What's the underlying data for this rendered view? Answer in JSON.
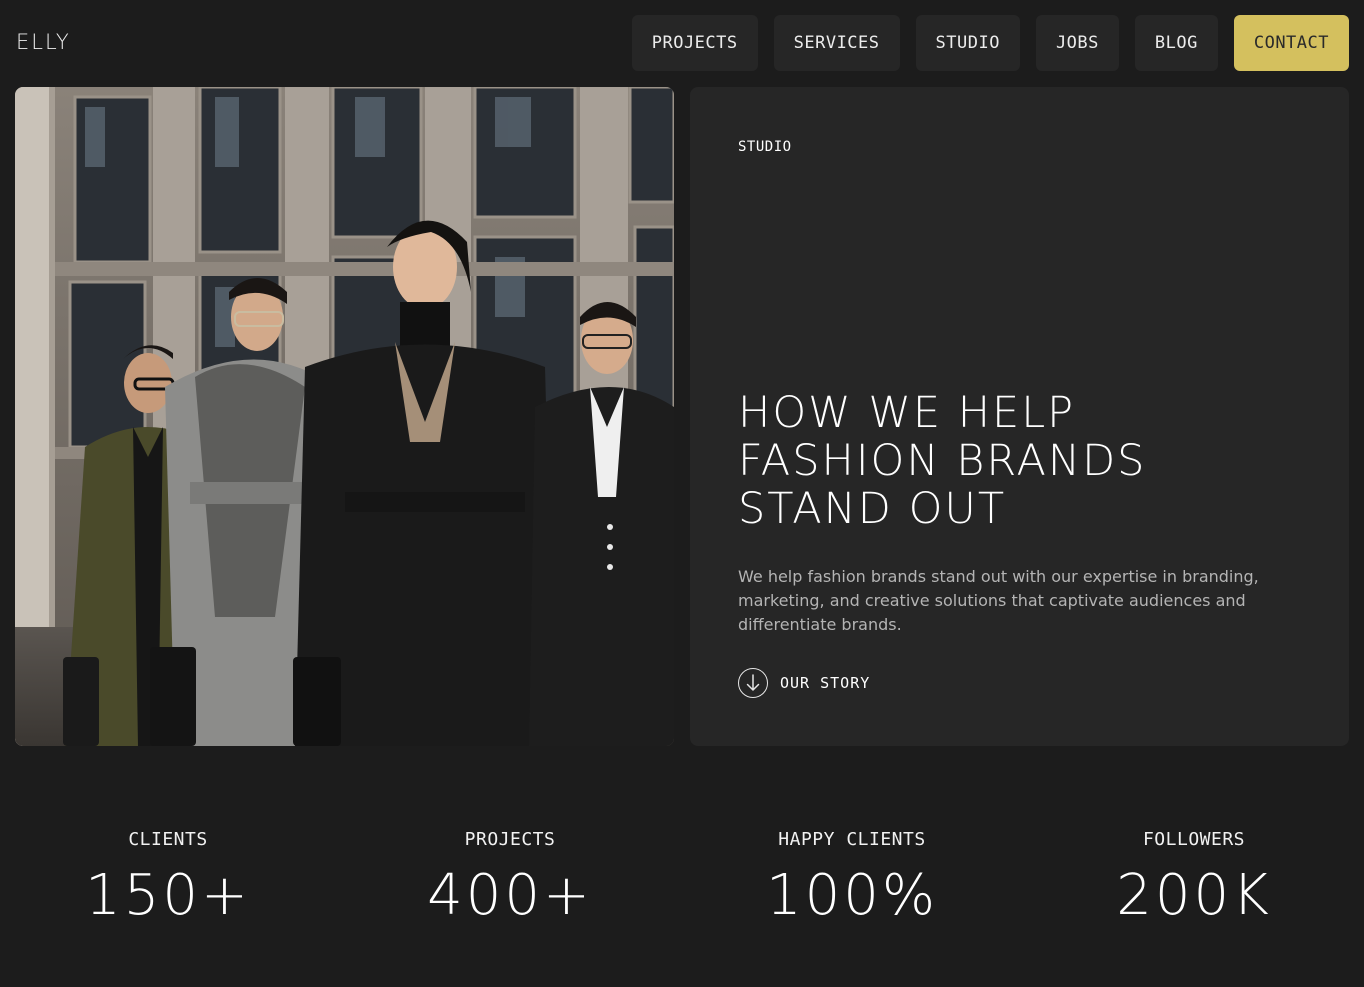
{
  "header": {
    "logo": "ELLY",
    "nav": [
      {
        "label": "PROJECTS"
      },
      {
        "label": "SERVICES"
      },
      {
        "label": "STUDIO"
      },
      {
        "label": "JOBS"
      },
      {
        "label": "BLOG"
      },
      {
        "label": "CONTACT",
        "accent": true
      }
    ],
    "accent_color": "#d4c05e"
  },
  "hero": {
    "image_icon": "photo-four-women-in-coats",
    "eyebrow": "STUDIO",
    "headline": [
      "HOW WE HELP",
      "FASHION BRANDS",
      "STAND OUT"
    ],
    "description": "We help fashion brands stand out with our expertise in branding, marketing, and creative solutions that captivate audiences and differentiate brands.",
    "cta": {
      "label": "OUR STORY",
      "icon": "arrow-down-circle-icon"
    }
  },
  "stats": [
    {
      "label": "CLIENTS",
      "value": "150+"
    },
    {
      "label": "PROJECTS",
      "value": "400+"
    },
    {
      "label": "HAPPY CLIENTS",
      "value": "100%"
    },
    {
      "label": "FOLLOWERS",
      "value": "200K"
    }
  ],
  "colors": {
    "background": "#1c1c1c",
    "card": "#262626",
    "muted_text": "#b4b4b4"
  }
}
